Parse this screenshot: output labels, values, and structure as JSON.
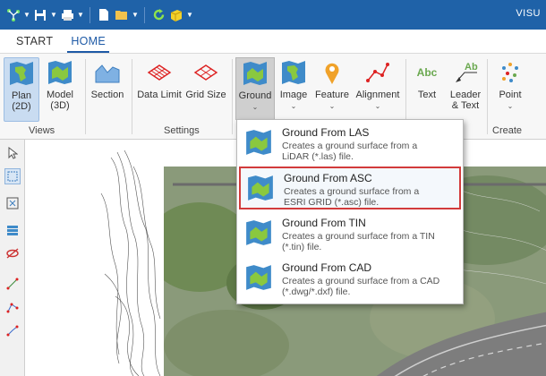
{
  "window": {
    "title": "VISU"
  },
  "ribbon_tabs": [
    "START",
    "HOME"
  ],
  "ribbon": {
    "plan": "Plan\n(2D)",
    "model": "Model\n(3D)",
    "section": "Section",
    "data_limit": "Data Limit",
    "grid_size": "Grid Size",
    "ground": "Ground",
    "image": "Image",
    "feature": "Feature",
    "alignment": "Alignment",
    "text": "Text",
    "leader_text": "Leader\n& Text",
    "point": "Point",
    "groups": {
      "views": "Views",
      "settings": "Settings",
      "create": "Create"
    }
  },
  "menu": {
    "items": [
      {
        "title": "Ground From LAS",
        "desc": "Creates a ground surface from a\nLiDAR (*.las) file."
      },
      {
        "title": "Ground From ASC",
        "desc": "Creates a ground surface from a\nESRI GRID (*.asc) file."
      },
      {
        "title": "Ground From TIN",
        "desc": "Creates a ground surface from a TIN\n(*.tin) file."
      },
      {
        "title": "Ground From CAD",
        "desc": "Creates a ground surface from a CAD\n(*.dwg/*.dxf) file."
      }
    ]
  },
  "colors": {
    "titlebar": "#1f62a8",
    "accent": "#1e5aa6",
    "highlight_border": "#d23b3b"
  }
}
